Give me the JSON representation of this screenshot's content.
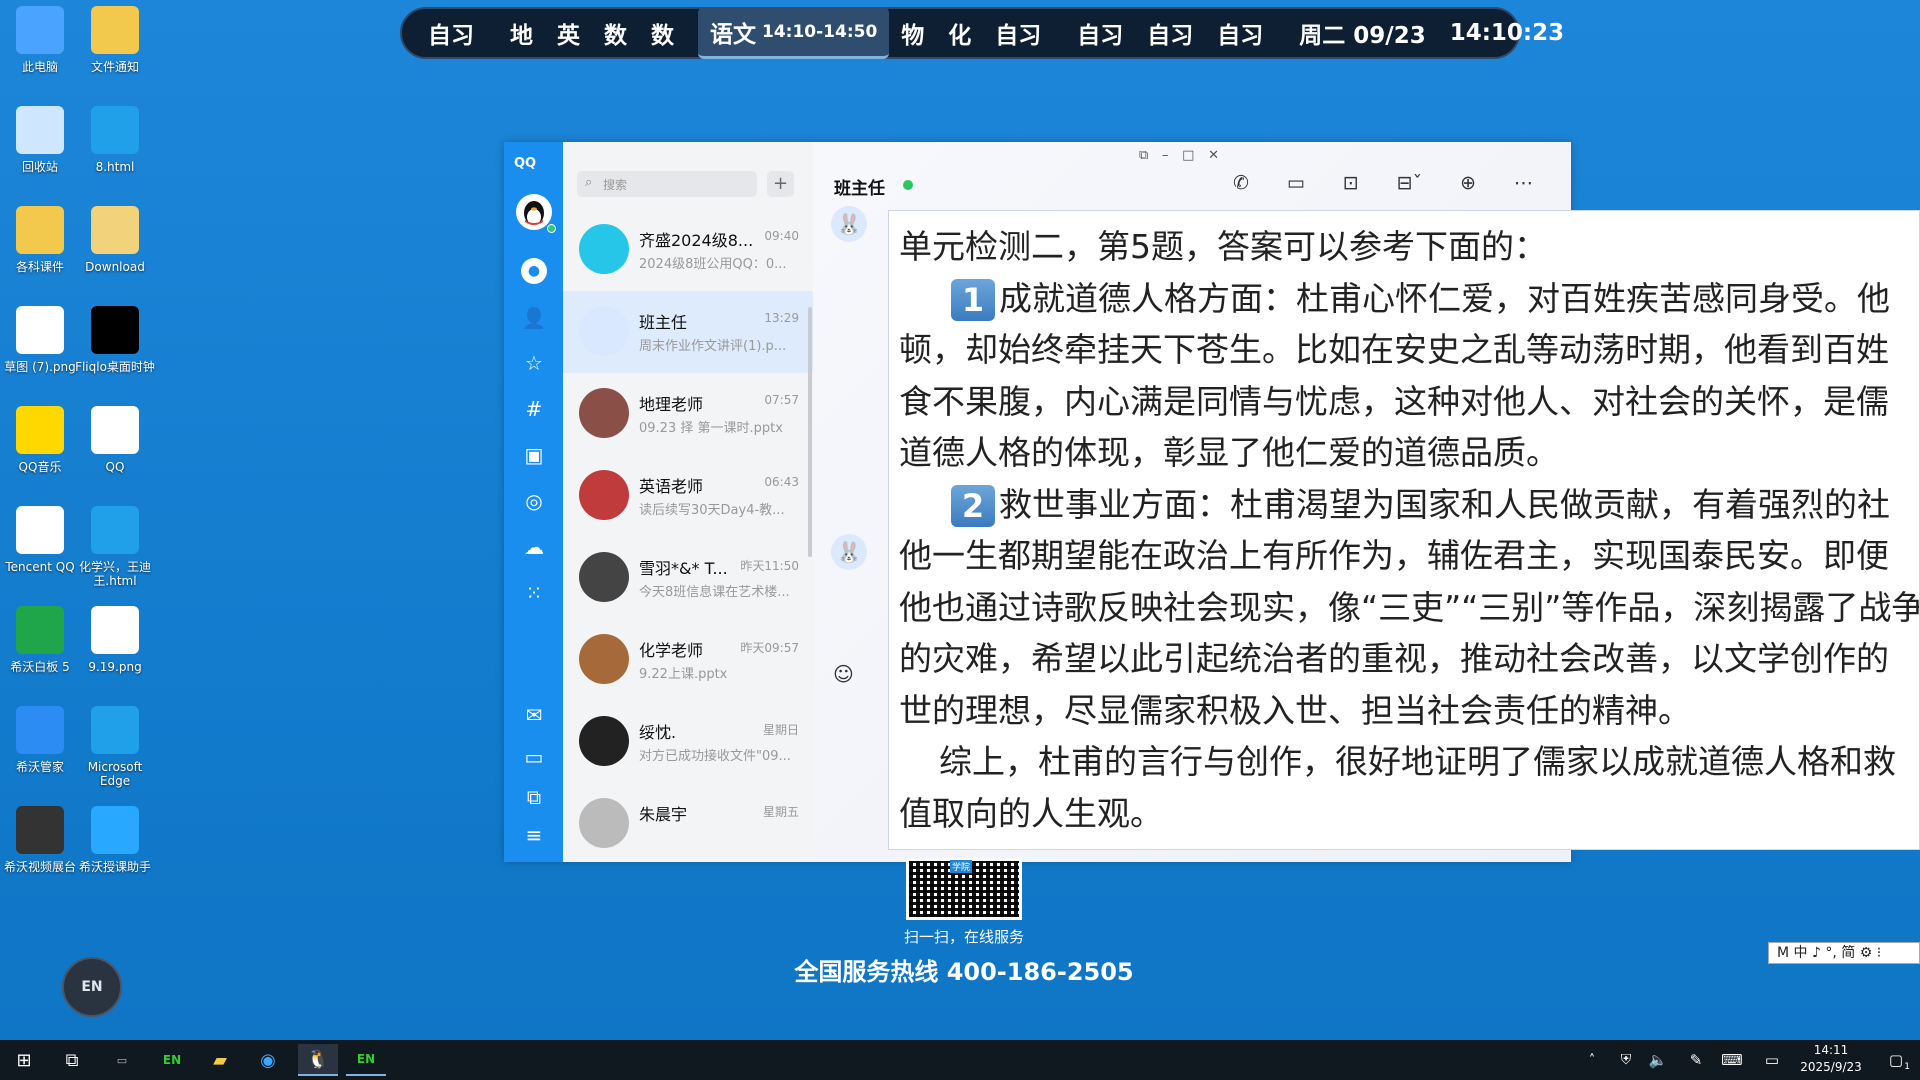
{
  "schedule": {
    "items": [
      "自习",
      "地",
      "英",
      "数",
      "数"
    ],
    "current": {
      "subject": "语文",
      "time": "14:10-14:50"
    },
    "items2": [
      "物",
      "化",
      "自习"
    ],
    "items3": [
      "自习",
      "自习",
      "自习"
    ],
    "date": "周二 09/23",
    "clock": "14:10:23"
  },
  "desktop_icons": [
    {
      "label": "此电脑",
      "icon": "computer-icon",
      "color": "#4aa3ff"
    },
    {
      "label": "文件通知",
      "icon": "folder-warning-icon",
      "color": "#f2c94c"
    },
    {
      "label": "回收站",
      "icon": "recycle-bin-icon",
      "color": "#cfe6ff"
    },
    {
      "label": "8.html",
      "icon": "edge-icon",
      "color": "#1fa0e8"
    },
    {
      "label": "各科课件",
      "icon": "folder-icon",
      "color": "#f2c94c"
    },
    {
      "label": "Download",
      "icon": "folder-icon",
      "color": "#f2d27a"
    },
    {
      "label": "草图 (7).png",
      "icon": "image-file-icon",
      "color": "#ffffff"
    },
    {
      "label": "Fliqlo桌面时钟",
      "icon": "clock-icon",
      "color": "#000000"
    },
    {
      "label": "QQ音乐",
      "icon": "qq-music-icon",
      "color": "#ffd800"
    },
    {
      "label": "QQ",
      "icon": "qq-icon",
      "color": "#ffffff"
    },
    {
      "label": "Tencent QQ",
      "icon": "qq-icon",
      "color": "#ffffff"
    },
    {
      "label": "化学兴，王迪王.html",
      "icon": "edge-icon",
      "color": "#1fa0e8"
    },
    {
      "label": "希沃白板 5",
      "icon": "en-board-icon",
      "color": "#1fa64a"
    },
    {
      "label": "9.19.png",
      "icon": "image-file-icon",
      "color": "#ffffff"
    },
    {
      "label": "希沃管家",
      "icon": "shield-icon",
      "color": "#2c8cf4"
    },
    {
      "label": "Microsoft Edge",
      "icon": "edge-icon",
      "color": "#1fa0e8"
    },
    {
      "label": "希沃视频展台",
      "icon": "camera-icon",
      "color": "#333333"
    },
    {
      "label": "希沃授课助手",
      "icon": "link-icon",
      "color": "#28a8ff"
    }
  ],
  "qq": {
    "logo": "QQ",
    "search_placeholder": "搜索",
    "add": "+",
    "chats": [
      {
        "name": "齐盛2024级8...",
        "time": "09:40",
        "preview": "2024级8班公用QQ：0...",
        "avatar": "#25c6e8"
      },
      {
        "name": "班主任",
        "time": "13:29",
        "preview": "周末作业作文讲评(1).p...",
        "avatar": "#d9e8ff",
        "selected": true
      },
      {
        "name": "地理老师",
        "time": "07:57",
        "preview": "09.23 择 第一课时.pptx",
        "avatar": "#8a5048"
      },
      {
        "name": "英语老师",
        "time": "06:43",
        "preview": "读后续写30天Day4-教...",
        "avatar": "#c03b3b"
      },
      {
        "name": "雪羽*&* T...",
        "time": "昨天11:50",
        "preview": "今天8班信息课在艺术楼...",
        "avatar": "#444444"
      },
      {
        "name": "化学老师",
        "time": "昨天09:57",
        "preview": "9.22上课.pptx",
        "avatar": "#a66a3a"
      },
      {
        "name": "绥忱.",
        "time": "星期日",
        "preview": "对方已成功接收文件\"09...",
        "avatar": "#222222"
      },
      {
        "name": "朱晨宇",
        "time": "星期五",
        "preview": "",
        "avatar": "#bbbbbb"
      }
    ],
    "chat_title": "班主任"
  },
  "overlay": {
    "line1": "单元检测二，第5题，答案可以参考下面的：",
    "badge1": "1",
    "line2": "成就道德人格方面：杜甫心怀仁爱，对百姓疾苦感同身受。他",
    "line3": "顿，却始终牵挂天下苍生。比如在安史之乱等动荡时期，他看到百姓",
    "line4": "食不果腹，内心满是同情与忧虑，这种对他人、对社会的关怀，是儒",
    "line5": "道德人格的体现，彰显了他仁爱的道德品质。",
    "badge2": "2",
    "line6": "救世事业方面：杜甫渴望为国家和人民做贡献，有着强烈的社",
    "line7": "他一生都期望能在政治上有所作为，辅佐君主，实现国泰民安。即便",
    "line8": "他也通过诗歌反映社会现实，像“三吏”“三别”等作品，深刻揭露了战争",
    "line9": "的灾难，希望以此引起统治者的重视，推动社会改善，以文学创作的",
    "line10": "世的理想，尽显儒家积极入世、担当社会责任的精神。",
    "line11": "综上，杜甫的言行与创作，很好地证明了儒家以成就道德人格和救",
    "line12": "值取向的人生观。"
  },
  "promo": {
    "qr_label": "学院",
    "scan_text": "扫一扫，在线服务",
    "hotline": "全国服务热线 400-186-2505"
  },
  "ime": {
    "text": "M 中 ♪ °, 简 ⚙ ⁝"
  },
  "float_btn": "EN",
  "taskbar": {
    "time": "14:11",
    "date": "2025/9/23",
    "notif_count": "1"
  }
}
